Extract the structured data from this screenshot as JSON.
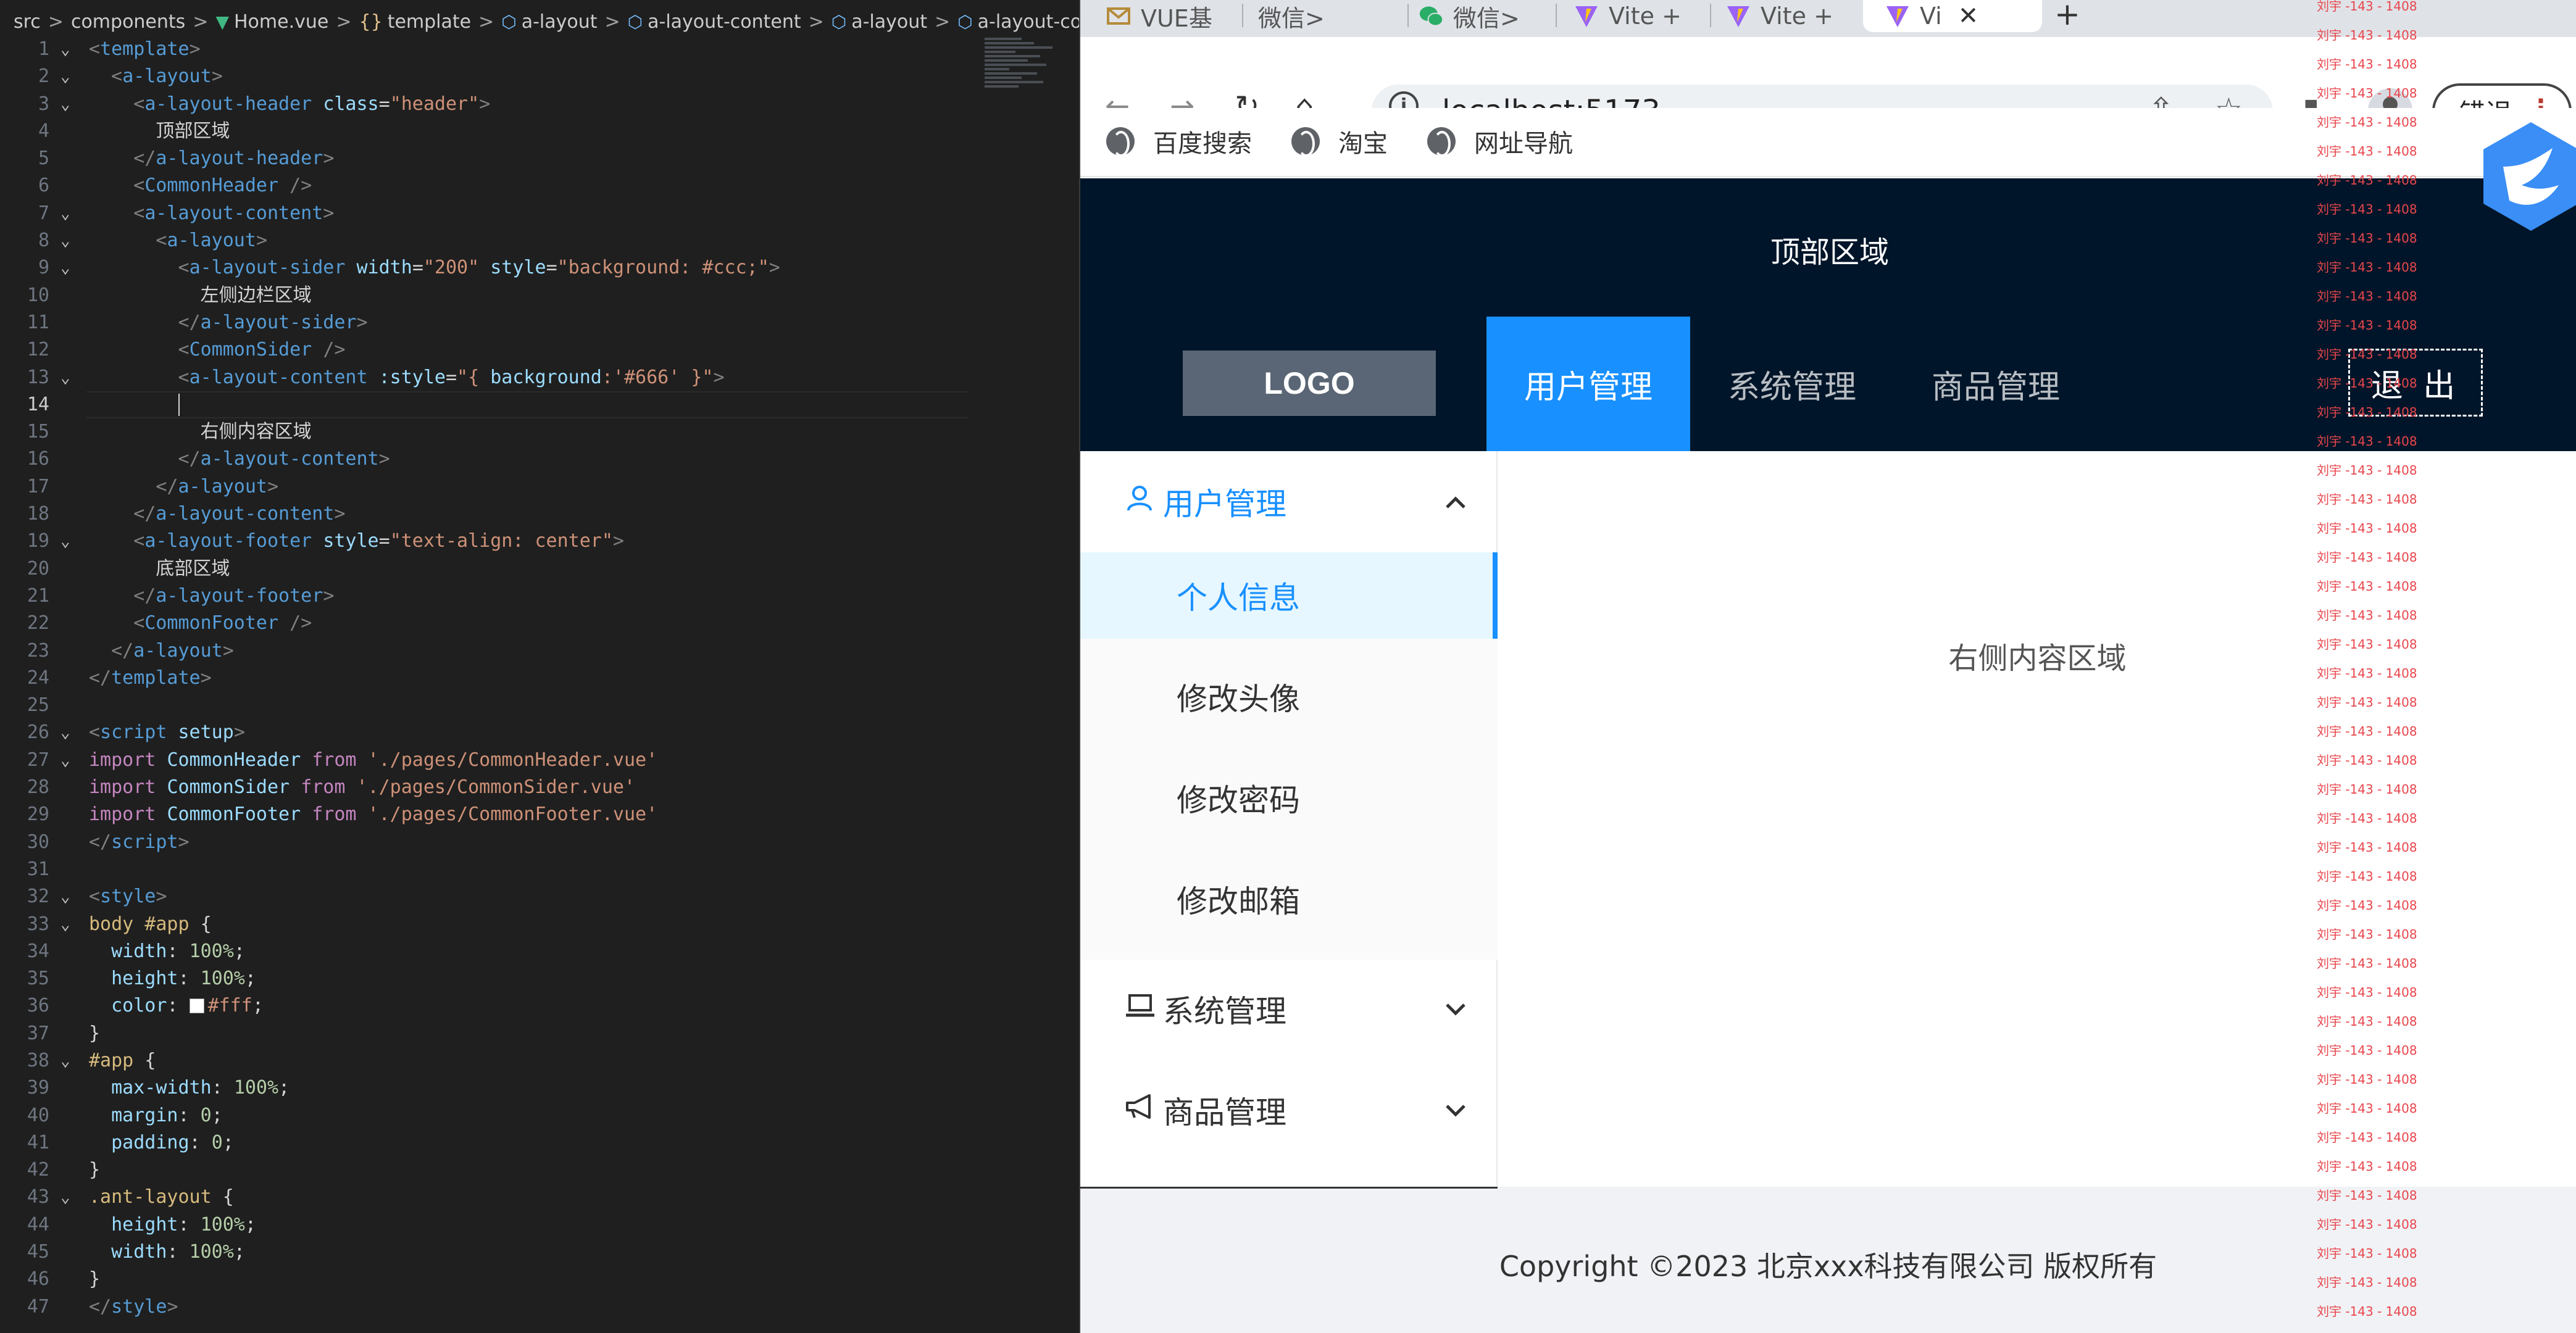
{
  "editor": {
    "breadcrumb": [
      "src",
      "components",
      "Home.vue",
      "template",
      "a-layout",
      "a-layout-content",
      "a-layout",
      "a-layout-content"
    ]
  },
  "browser": {
    "tabs": [
      {
        "label": "VUE基"
      },
      {
        "label": "微信>"
      },
      {
        "label": "微信>"
      },
      {
        "label": "Vite +"
      },
      {
        "label": "Vite +"
      },
      {
        "label": "Vi"
      }
    ],
    "url": "localhost:5173",
    "error_button": "错误",
    "bookmarks": [
      "百度搜索",
      "淘宝",
      "网址导航"
    ]
  },
  "app": {
    "header_top": "顶部区域",
    "logo": "LOGO",
    "top_menu": [
      "用户管理",
      "系统管理",
      "商品管理"
    ],
    "logout": "退 出",
    "sider": {
      "user_mgmt": "用户管理",
      "items": [
        "个人信息",
        "修改头像",
        "修改密码",
        "修改邮箱"
      ],
      "system_mgmt": "系统管理",
      "goods_mgmt": "商品管理"
    },
    "content": "右侧内容区域",
    "footer": "Copyright ©2023 北京xxx科技有限公司 版权所有"
  },
  "watermark": "刘宇 -143 - 1408",
  "colors": {
    "primary": "#1890ff",
    "header": "#001529",
    "footer_bg": "#f0f2f5"
  }
}
